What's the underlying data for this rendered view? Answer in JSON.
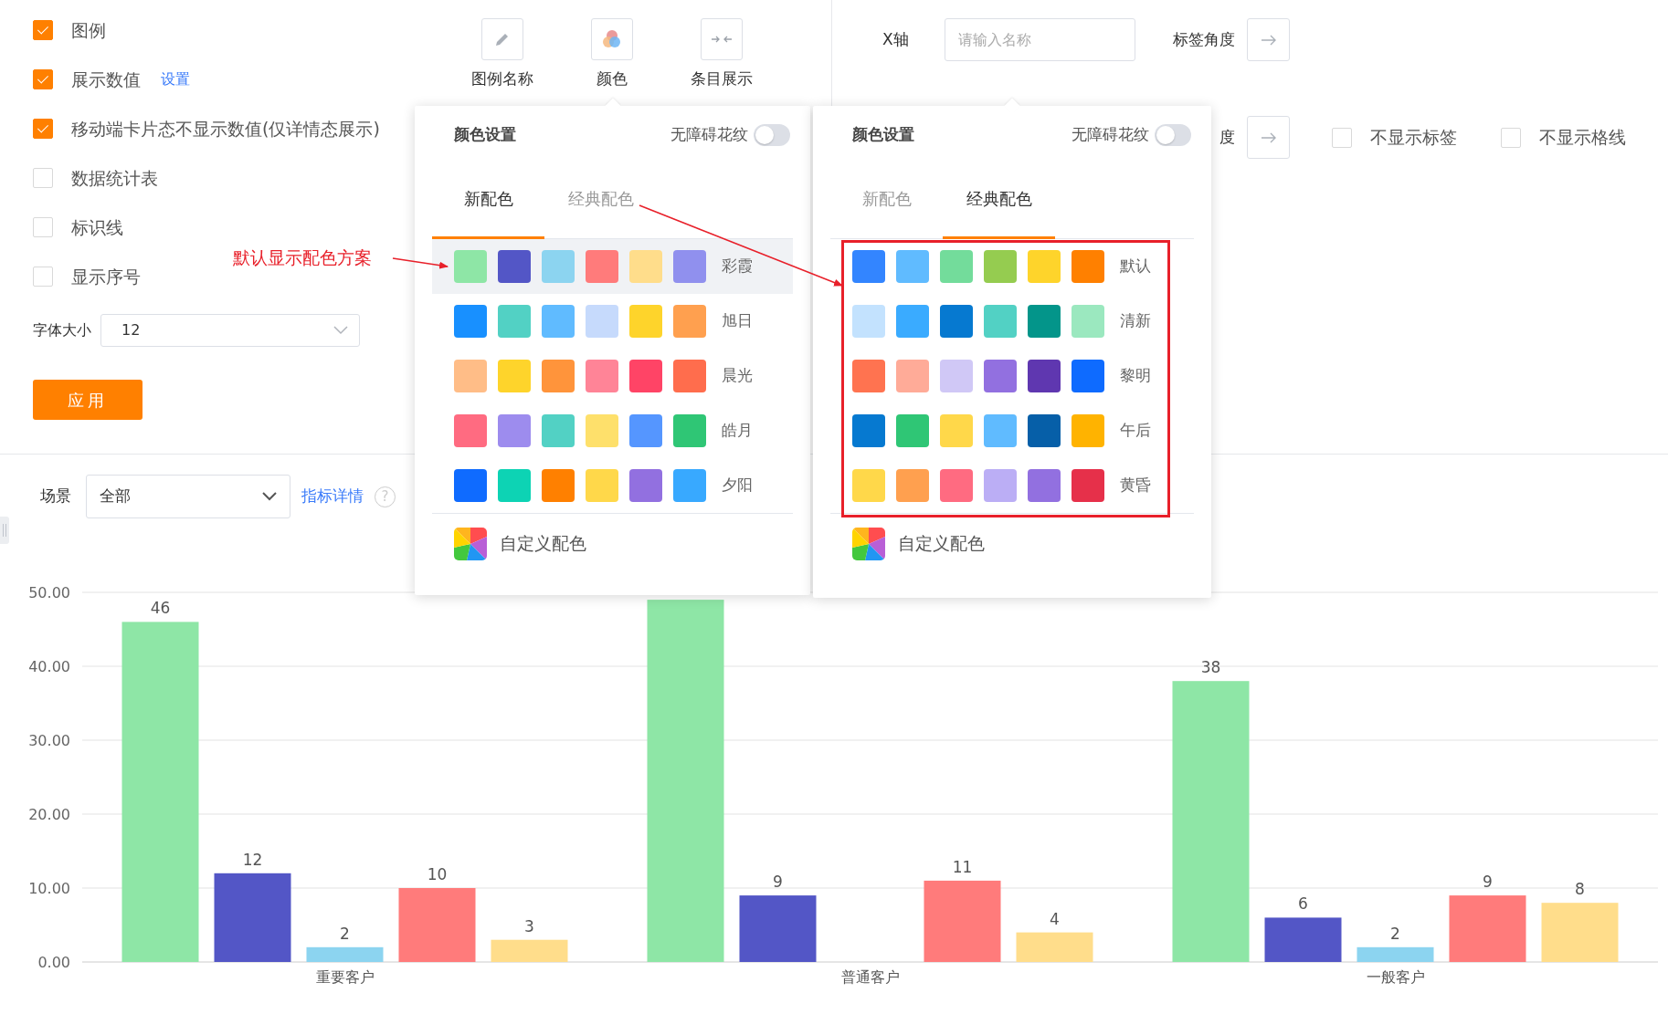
{
  "options": [
    {
      "label": "图例",
      "checked": true
    },
    {
      "label": "展示数值",
      "checked": true,
      "link": "设置"
    },
    {
      "label": "移动端卡片态不显示数值(仅详情态展示)",
      "checked": true
    },
    {
      "label": "数据统计表",
      "checked": false
    },
    {
      "label": "标识线",
      "checked": false
    },
    {
      "label": "显示序号",
      "checked": false
    }
  ],
  "font_size": {
    "label": "字体大小",
    "value": "12"
  },
  "apply_button": "应用",
  "toolbar": [
    {
      "label": "图例名称",
      "kind": "pencil"
    },
    {
      "label": "颜色",
      "kind": "palette"
    },
    {
      "label": "条目展示",
      "kind": "collapse"
    }
  ],
  "axis": {
    "x_label": "X轴",
    "name_placeholder": "请输入名称",
    "angle_label": "标签角度",
    "angle_label_2": "度",
    "checks": [
      {
        "label": "不显示标签",
        "checked": false
      },
      {
        "label": "不显示格线",
        "checked": false
      }
    ]
  },
  "scene": {
    "label": "场景",
    "value": "全部",
    "link": "指标详情",
    "help": "?"
  },
  "color_panels": [
    {
      "title": "颜色设置",
      "pattern_label": "无障碍花纹",
      "pattern_on": false,
      "tabs": [
        {
          "label": "新配色",
          "selected": true
        },
        {
          "label": "经典配色",
          "selected": false
        }
      ],
      "schemes": [
        {
          "name": "彩霞",
          "selected": true,
          "swatches": [
            {
              "color": "#8ee6a6"
            },
            {
              "color": "#5356c6"
            },
            {
              "color": "#8cd4f0"
            },
            {
              "color": "#ff7b7b"
            },
            {
              "color": "#ffdd8b"
            },
            {
              "color": "#9090ee"
            }
          ]
        },
        {
          "name": "旭日",
          "selected": false,
          "swatches": [
            {
              "color": "#1890ff"
            },
            {
              "color": "#52d1c4"
            },
            {
              "color": "#60bbff"
            },
            {
              "color": "#c6dafc"
            },
            {
              "color": "#fed42b"
            },
            {
              "color": "#ffa04f"
            }
          ]
        },
        {
          "name": "晨光",
          "selected": false,
          "swatches": [
            {
              "color": "#ffbd87"
            },
            {
              "color": "#fed42b"
            },
            {
              "color": "#ff943b"
            },
            {
              "color": "#ff8497"
            },
            {
              "color": "#ff4466"
            },
            {
              "color": "#ff6d4d"
            }
          ]
        },
        {
          "name": "皓月",
          "selected": false,
          "swatches": [
            {
              "color": "#ff6b81"
            },
            {
              "color": "#9d8cee"
            },
            {
              "color": "#52d1c4"
            },
            {
              "color": "#fee06b"
            },
            {
              "color": "#5596ff"
            },
            {
              "color": "#2fc675"
            }
          ]
        },
        {
          "name": "夕阳",
          "selected": false,
          "swatches": [
            {
              "color": "#0f6bff"
            },
            {
              "color": "#0dd3b4"
            },
            {
              "color": "#ff8000"
            },
            {
              "color": "#ffd84a"
            },
            {
              "color": "#9270e0"
            },
            {
              "color": "#38a9ff"
            }
          ]
        }
      ],
      "custom": "自定义配色"
    },
    {
      "title": "颜色设置",
      "pattern_label": "无障碍花纹",
      "pattern_on": false,
      "tabs": [
        {
          "label": "新配色",
          "selected": false
        },
        {
          "label": "经典配色",
          "selected": true
        }
      ],
      "schemes": [
        {
          "name": "默认",
          "selected": false,
          "swatches": [
            {
              "color": "#3385ff"
            },
            {
              "color": "#60bbff"
            },
            {
              "color": "#73dc9b"
            },
            {
              "color": "#95cc50"
            },
            {
              "color": "#fed42b"
            },
            {
              "color": "#ff8000"
            }
          ]
        },
        {
          "name": "清新",
          "selected": false,
          "swatches": [
            {
              "color": "#c3e2fe"
            },
            {
              "color": "#3aabff"
            },
            {
              "color": "#0679d0"
            },
            {
              "color": "#52d1c4"
            },
            {
              "color": "#03958a"
            },
            {
              "color": "#9be8bf"
            }
          ]
        },
        {
          "name": "黎明",
          "selected": false,
          "swatches": [
            {
              "color": "#ff7350"
            },
            {
              "color": "#ffab98"
            },
            {
              "color": "#d0c8f6"
            },
            {
              "color": "#9270e0"
            },
            {
              "color": "#5f37b0"
            },
            {
              "color": "#0e6bff"
            }
          ]
        },
        {
          "name": "午后",
          "selected": false,
          "swatches": [
            {
              "color": "#0679d0"
            },
            {
              "color": "#2fc675"
            },
            {
              "color": "#ffd84a"
            },
            {
              "color": "#60bbff"
            },
            {
              "color": "#065fa8"
            },
            {
              "color": "#ffb300"
            }
          ]
        },
        {
          "name": "黄昏",
          "selected": false,
          "swatches": [
            {
              "color": "#ffd84a"
            },
            {
              "color": "#ffa04f"
            },
            {
              "color": "#ff6b81"
            },
            {
              "color": "#bbaef5"
            },
            {
              "color": "#9270e0"
            },
            {
              "color": "#e6304a"
            }
          ]
        }
      ],
      "custom": "自定义配色"
    }
  ],
  "annotation": {
    "text": "默认显示配色方案"
  },
  "chart_data": {
    "type": "bar",
    "categories": [
      "重要客户",
      "普通客户",
      "一般客户"
    ],
    "series": [
      {
        "color": "#8ee6a6",
        "values": [
          46,
          49,
          38
        ]
      },
      {
        "color": "#5356c6",
        "values": [
          12,
          9,
          6
        ]
      },
      {
        "color": "#8cd4f0",
        "values": [
          2,
          null,
          2
        ]
      },
      {
        "color": "#ff7b7b",
        "values": [
          10,
          11,
          9
        ]
      },
      {
        "color": "#ffdd8b",
        "values": [
          3,
          4,
          8
        ]
      }
    ],
    "ylim": [
      0,
      50
    ],
    "yticks": [
      {
        "value": 0,
        "label": "0.00"
      },
      {
        "value": 10,
        "label": "10.00"
      },
      {
        "value": 20,
        "label": "20.00"
      },
      {
        "value": 30,
        "label": "30.00"
      },
      {
        "value": 40,
        "label": "40.00"
      },
      {
        "value": 50,
        "label": "50.00"
      }
    ],
    "grid": true,
    "value_labels": [
      [
        "46",
        null,
        "38"
      ],
      [
        "12",
        "9",
        "6"
      ],
      [
        "2",
        null,
        "2"
      ],
      [
        "10",
        "11",
        "9"
      ],
      [
        "3",
        "4",
        "8"
      ]
    ]
  }
}
